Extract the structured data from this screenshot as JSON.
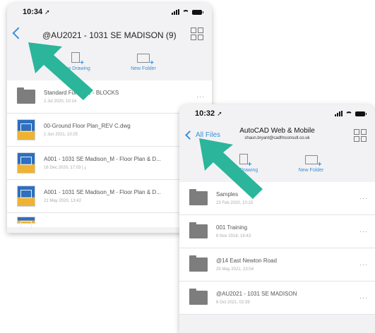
{
  "phone_a": {
    "status": {
      "time": "10:34",
      "location_glyph": "➚"
    },
    "nav": {
      "title": "@AU2021 - 1031 SE MADISON (9)"
    },
    "toolbar": {
      "new_drawing": "New Drawing",
      "new_folder": "New Folder"
    },
    "items": [
      {
        "kind": "folder",
        "name": "Standard Furniture - BLOCKS",
        "date": "2 Jul 2020, 10:14"
      },
      {
        "kind": "dwg",
        "name": "00-Ground Floor Plan_REV C.dwg",
        "date": "1 Jun 2021, 10:25"
      },
      {
        "kind": "dwg",
        "name": "A001 - 1031 SE Madison_M - Floor Plan & D...",
        "date": "16 Dec 2020, 17:03 | ⤓"
      },
      {
        "kind": "dwg",
        "name": "A001 - 1031 SE Madison_M - Floor Plan & D...",
        "date": "21 May 2020, 13:42"
      }
    ]
  },
  "phone_b": {
    "status": {
      "time": "10:32",
      "location_glyph": "➚"
    },
    "nav": {
      "back_label": "All Files",
      "title": "AutoCAD Web & Mobile",
      "subtitle": "shaun.bryant@cadfmconsult.co.uk"
    },
    "toolbar": {
      "new_drawing": "New Drawing",
      "new_folder": "New Folder"
    },
    "items": [
      {
        "kind": "folder",
        "name": "Samples",
        "date": "23 Feb 2020, 10:15"
      },
      {
        "kind": "folder",
        "name": "001 Training",
        "date": "6 Nov 2018, 16:43"
      },
      {
        "kind": "folder",
        "name": "@14 East Newton Road",
        "date": "25 May 2021, 23:04"
      },
      {
        "kind": "folder",
        "name": "@AU2021 - 1031 SE MADISON",
        "date": "6 Oct 2021, 02:39"
      }
    ],
    "more_glyph": "···"
  },
  "colors": {
    "accent": "#3a8fd9",
    "arrow": "#2bb59b",
    "folder": "#7d7d7d"
  }
}
